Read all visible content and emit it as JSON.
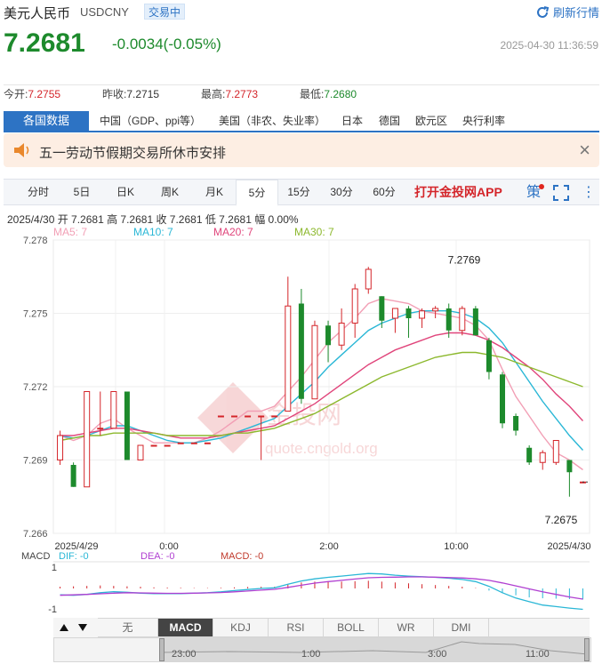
{
  "header": {
    "name": "美元人民币",
    "code": "USDCNY",
    "status": "交易中",
    "refresh_label": "刷新行情"
  },
  "quote": {
    "price": "7.2681",
    "change": "-0.0034(-0.05%)",
    "timestamp": "2025-04-30 11:36:59"
  },
  "stats": [
    {
      "label": "今开:",
      "value": "7.2755",
      "color": "#d4252a"
    },
    {
      "label": "昨收:",
      "value": "7.2715",
      "color": "#333333"
    },
    {
      "label": "最高:",
      "value": "7.2773",
      "color": "#d4252a"
    },
    {
      "label": "最低:",
      "value": "7.2680",
      "color": "#1d8a2c"
    }
  ],
  "category_tabs": [
    "各国数据",
    "中国（GDP、ppi等）",
    "美国（非农、失业率）",
    "日本",
    "德国",
    "欧元区",
    "央行利率"
  ],
  "notice": {
    "text": "五一劳动节假期交易所休市安排"
  },
  "period_tabs": [
    "分时",
    "5日",
    "日K",
    "周K",
    "月K",
    "5分",
    "15分",
    "30分",
    "60分"
  ],
  "active_period": "5分",
  "app_link": "打开金投网APP",
  "ce_label": "策",
  "ohlc_line": "2025/4/30  开 7.2681  高 7.2681  收 7.2681  低 7.2681  幅 0.00%",
  "ma_legend": [
    {
      "label": "MA5: 7",
      "color": "#f29fb5"
    },
    {
      "label": "MA10: 7",
      "color": "#2ab7d6"
    },
    {
      "label": "MA20: 7",
      "color": "#e0457b"
    },
    {
      "label": "MA30: 7",
      "color": "#8cb82d"
    }
  ],
  "watermark": {
    "cn": "金投网",
    "url": "quote.cngold.org"
  },
  "chart_data": {
    "type": "candlestick",
    "y_ticks": [
      "7.278",
      "7.275",
      "7.272",
      "7.269",
      "7.266"
    ],
    "ylim": [
      7.266,
      7.278
    ],
    "x_labels": [
      "2025/4/29",
      "0:00",
      "2:00",
      "10:00",
      "2025/4/30"
    ],
    "annotations": [
      {
        "label": "7.2769",
        "value": 7.2769
      },
      {
        "label": "7.2675",
        "value": 7.2675
      }
    ],
    "candles": [
      {
        "o": 7.269,
        "c": 7.27,
        "h": 7.2702,
        "l": 7.2688
      },
      {
        "o": 7.2688,
        "c": 7.2679,
        "h": 7.2689,
        "l": 7.2679
      },
      {
        "o": 7.2679,
        "c": 7.2718,
        "h": 7.2718,
        "l": 7.2679
      },
      {
        "o": 7.2703,
        "c": 7.2703,
        "h": 7.2718,
        "l": 7.27
      },
      {
        "o": 7.2703,
        "c": 7.2718,
        "h": 7.2718,
        "l": 7.2703
      },
      {
        "o": 7.2718,
        "c": 7.269,
        "h": 7.2718,
        "l": 7.269
      },
      {
        "o": 7.269,
        "c": 7.2696,
        "h": 7.2696,
        "l": 7.269
      },
      {
        "o": 7.2696,
        "c": 7.2696,
        "h": 7.2696,
        "l": 7.2696
      },
      {
        "o": 7.2696,
        "c": 7.2696,
        "h": 7.2696,
        "l": 7.2696
      },
      {
        "o": 7.2697,
        "c": 7.2697,
        "h": 7.2697,
        "l": 7.2697
      },
      {
        "o": 7.2697,
        "c": 7.2697,
        "h": 7.2697,
        "l": 7.2697
      },
      {
        "o": 7.2697,
        "c": 7.2697,
        "h": 7.2697,
        "l": 7.2697
      },
      {
        "o": 7.2708,
        "c": 7.2708,
        "h": 7.2708,
        "l": 7.2708
      },
      {
        "o": 7.2708,
        "c": 7.2708,
        "h": 7.2708,
        "l": 7.2708
      },
      {
        "o": 7.2708,
        "c": 7.2708,
        "h": 7.2708,
        "l": 7.2708
      },
      {
        "o": 7.2708,
        "c": 7.2708,
        "h": 7.2708,
        "l": 7.269
      },
      {
        "o": 7.2708,
        "c": 7.2708,
        "h": 7.2708,
        "l": 7.2708
      },
      {
        "o": 7.271,
        "c": 7.2753,
        "h": 7.2765,
        "l": 7.271
      },
      {
        "o": 7.2754,
        "c": 7.2715,
        "h": 7.276,
        "l": 7.2713
      },
      {
        "o": 7.2715,
        "c": 7.2745,
        "h": 7.2747,
        "l": 7.2715
      },
      {
        "o": 7.2745,
        "c": 7.2737,
        "h": 7.2747,
        "l": 7.273
      },
      {
        "o": 7.2737,
        "c": 7.2746,
        "h": 7.2752,
        "l": 7.2735
      },
      {
        "o": 7.2746,
        "c": 7.276,
        "h": 7.2762,
        "l": 7.274
      },
      {
        "o": 7.276,
        "c": 7.2768,
        "h": 7.2769,
        "l": 7.2758
      },
      {
        "o": 7.2757,
        "c": 7.2747,
        "h": 7.2757,
        "l": 7.2744
      },
      {
        "o": 7.2748,
        "c": 7.2752,
        "h": 7.2752,
        "l": 7.2742
      },
      {
        "o": 7.2752,
        "c": 7.2748,
        "h": 7.2753,
        "l": 7.274
      },
      {
        "o": 7.2748,
        "c": 7.2751,
        "h": 7.2752,
        "l": 7.2744
      },
      {
        "o": 7.2751,
        "c": 7.2752,
        "h": 7.2753,
        "l": 7.2748
      },
      {
        "o": 7.2752,
        "c": 7.2743,
        "h": 7.2754,
        "l": 7.274
      },
      {
        "o": 7.2743,
        "c": 7.2752,
        "h": 7.2753,
        "l": 7.2741
      },
      {
        "o": 7.2752,
        "c": 7.2741,
        "h": 7.2753,
        "l": 7.2741
      },
      {
        "o": 7.2739,
        "c": 7.2726,
        "h": 7.274,
        "l": 7.2723
      },
      {
        "o": 7.2725,
        "c": 7.2705,
        "h": 7.2726,
        "l": 7.2703
      },
      {
        "o": 7.2708,
        "c": 7.2702,
        "h": 7.2709,
        "l": 7.27
      },
      {
        "o": 7.2695,
        "c": 7.2689,
        "h": 7.2696,
        "l": 7.2688
      },
      {
        "o": 7.2689,
        "c": 7.2693,
        "h": 7.2694,
        "l": 7.2686
      },
      {
        "o": 7.2689,
        "c": 7.2698,
        "h": 7.2698,
        "l": 7.2688
      },
      {
        "o": 7.269,
        "c": 7.2685,
        "h": 7.269,
        "l": 7.2675
      },
      {
        "o": 7.2681,
        "c": 7.2681,
        "h": 7.2681,
        "l": 7.2681
      }
    ],
    "ma_series": [
      {
        "name": "MA5",
        "color": "#f29fb5",
        "values": [
          7.27,
          7.2698,
          7.27,
          7.2705,
          7.2707,
          7.2703,
          7.27,
          7.2697,
          7.2697,
          7.2697,
          7.2697,
          7.2699,
          7.2702,
          7.2706,
          7.271,
          7.271,
          7.2712,
          7.2718,
          7.2724,
          7.2731,
          7.2738,
          7.2743,
          7.2748,
          7.2754,
          7.2756,
          7.2755,
          7.2754,
          7.2751,
          7.275,
          7.2749,
          7.2748,
          7.2745,
          7.2739,
          7.2727,
          7.2716,
          7.2708,
          7.27,
          7.2693,
          7.269,
          7.2686
        ]
      },
      {
        "name": "MA10",
        "color": "#2ab7d6",
        "values": [
          7.27,
          7.2699,
          7.27,
          7.2702,
          7.2704,
          7.2704,
          7.2702,
          7.27,
          7.2698,
          7.2697,
          7.2697,
          7.2698,
          7.2699,
          7.2701,
          7.2703,
          7.2705,
          7.2707,
          7.2712,
          7.2717,
          7.2722,
          7.2728,
          7.2733,
          7.2738,
          7.2743,
          7.2746,
          7.2748,
          7.275,
          7.2751,
          7.2751,
          7.2751,
          7.275,
          7.2748,
          7.2744,
          7.2738,
          7.273,
          7.2722,
          7.2714,
          7.2707,
          7.27,
          7.2694
        ]
      },
      {
        "name": "MA20",
        "color": "#e0457b",
        "values": [
          7.27,
          7.27,
          7.2701,
          7.2702,
          7.2703,
          7.2703,
          7.2702,
          7.2701,
          7.27,
          7.2699,
          7.2699,
          7.2699,
          7.27,
          7.2701,
          7.2702,
          7.2703,
          7.2704,
          7.2707,
          7.271,
          7.2713,
          7.2717,
          7.2721,
          7.2725,
          7.2729,
          7.2732,
          7.2735,
          7.2737,
          7.2739,
          7.2741,
          7.2742,
          7.2742,
          7.2741,
          7.2739,
          7.2736,
          7.2732,
          7.2728,
          7.2723,
          7.2717,
          7.2712,
          7.2706
        ]
      },
      {
        "name": "MA30",
        "color": "#8cb82d",
        "values": [
          7.2698,
          7.2699,
          7.27,
          7.27,
          7.2701,
          7.2701,
          7.2701,
          7.2701,
          7.27,
          7.27,
          7.27,
          7.27,
          7.27,
          7.2701,
          7.2701,
          7.2702,
          7.2703,
          7.2705,
          7.2707,
          7.2709,
          7.2712,
          7.2715,
          7.2718,
          7.2721,
          7.2724,
          7.2726,
          7.2728,
          7.273,
          7.2732,
          7.2733,
          7.2734,
          7.2734,
          7.2733,
          7.2732,
          7.273,
          7.2728,
          7.2726,
          7.2724,
          7.2722,
          7.272
        ]
      }
    ]
  },
  "macd": {
    "label": "MACD",
    "dif": "DIF: -0",
    "dea": "DEA: -0",
    "macd": "MACD: -0",
    "ticks": [
      "1",
      "-1"
    ],
    "hist": [
      0.08,
      0.1,
      0.12,
      0.14,
      0.12,
      0.1,
      0.08,
      0.05,
      0.04,
      0.03,
      0.02,
      0.02,
      0.03,
      0.05,
      0.07,
      0.08,
      0.08,
      0.18,
      0.28,
      0.32,
      0.33,
      0.32,
      0.34,
      0.36,
      0.32,
      0.28,
      0.24,
      0.2,
      0.16,
      0.12,
      0.08,
      0.02,
      -0.1,
      -0.22,
      -0.32,
      -0.42,
      -0.46,
      -0.48,
      -0.5,
      -0.52
    ],
    "dif_values": [
      -0.3,
      -0.32,
      -0.28,
      -0.2,
      -0.15,
      -0.18,
      -0.22,
      -0.24,
      -0.24,
      -0.24,
      -0.22,
      -0.2,
      -0.16,
      -0.1,
      -0.05,
      0.0,
      0.03,
      0.2,
      0.35,
      0.45,
      0.52,
      0.58,
      0.64,
      0.7,
      0.68,
      0.62,
      0.58,
      0.55,
      0.52,
      0.48,
      0.42,
      0.32,
      0.1,
      -0.2,
      -0.45,
      -0.62,
      -0.78,
      -0.85,
      -0.92,
      -0.98
    ],
    "dea_values": [
      -0.32,
      -0.3,
      -0.28,
      -0.25,
      -0.22,
      -0.2,
      -0.21,
      -0.22,
      -0.23,
      -0.23,
      -0.22,
      -0.21,
      -0.19,
      -0.16,
      -0.12,
      -0.08,
      -0.04,
      0.05,
      0.15,
      0.25,
      0.32,
      0.38,
      0.44,
      0.5,
      0.52,
      0.53,
      0.54,
      0.54,
      0.53,
      0.51,
      0.49,
      0.45,
      0.38,
      0.26,
      0.12,
      -0.02,
      -0.16,
      -0.28,
      -0.4,
      -0.5
    ]
  },
  "indicator_tabs": [
    "无",
    "MACD",
    "KDJ",
    "RSI",
    "BOLL",
    "WR",
    "DMI"
  ],
  "active_indicator": "MACD",
  "navigator": {
    "labels": [
      "23:00",
      "1:00",
      "3:00",
      "11:00"
    ]
  },
  "colors": {
    "up": "#d4252a",
    "down": "#1d8a2c",
    "accent": "#2d73c4"
  }
}
